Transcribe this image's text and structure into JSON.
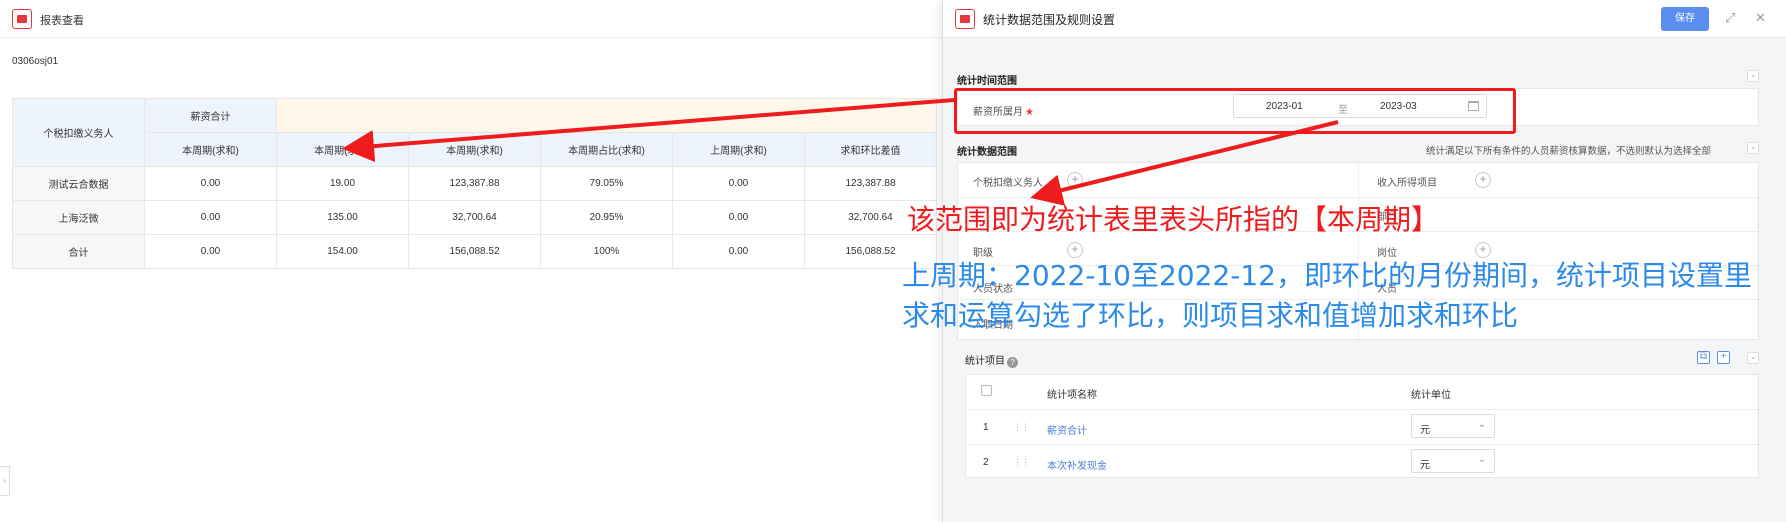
{
  "left_panel": {
    "title": "报表查看",
    "report_code": "0306osj01",
    "table": {
      "row_header_label": "个税扣缴义务人",
      "group_header": "薪资合计",
      "columns": [
        "本周期(求和)",
        "本周期(求和)",
        "本周期(求和)",
        "本周期占比(求和)",
        "上周期(求和)",
        "求和环比差值"
      ],
      "rows": [
        {
          "name": "测试云合数据",
          "values": [
            "0.00",
            "19.00",
            "123,387.88",
            "79.05%",
            "0.00",
            "123,387.88"
          ]
        },
        {
          "name": "上海泛微",
          "values": [
            "0.00",
            "135.00",
            "32,700.64",
            "20.95%",
            "0.00",
            "32,700.64"
          ]
        },
        {
          "name": "合计",
          "values": [
            "0.00",
            "154.00",
            "156,088.52",
            "100%",
            "0.00",
            "156,088.52"
          ]
        }
      ]
    }
  },
  "drawer": {
    "title": "统计数据范围及规则设置",
    "save_label": "保存",
    "time_section_title": "统计时间范围",
    "salary_month_label": "薪资所属月",
    "date_from": "2023-01",
    "date_sep": "至",
    "date_to": "2023-03",
    "data_section_title": "统计数据范围",
    "data_section_hint": "统计满足以下所有条件的人员薪资核算数据，不选则默认为选择全部",
    "conditions": {
      "withholding_agent": "个税扣缴义务人",
      "income_item": "收入所得项目",
      "dept": "部门",
      "job_level": "职级",
      "position": "岗位",
      "personnel_status": "人员状态",
      "personnel": "人员",
      "entry_date": "入职日期"
    },
    "items_section_title": "统计项目",
    "items_table": {
      "col_name": "统计项名称",
      "col_unit": "统计单位",
      "rows": [
        {
          "no": "1",
          "name": "薪资合计",
          "unit": "元"
        },
        {
          "no": "2",
          "name": "本次补发现金",
          "unit": "元"
        }
      ]
    }
  },
  "annotations": {
    "red_text": "该范围即为统计表里表头所指的【本周期】",
    "blue_text": "上周期：2022-10至2022-12，即环比的月份期间，统计项目设置里求和运算勾选了环比，则项目求和值增加求和环比",
    "colors": {
      "red": "#ee1c1c",
      "blue": "#2c8ae8"
    }
  }
}
